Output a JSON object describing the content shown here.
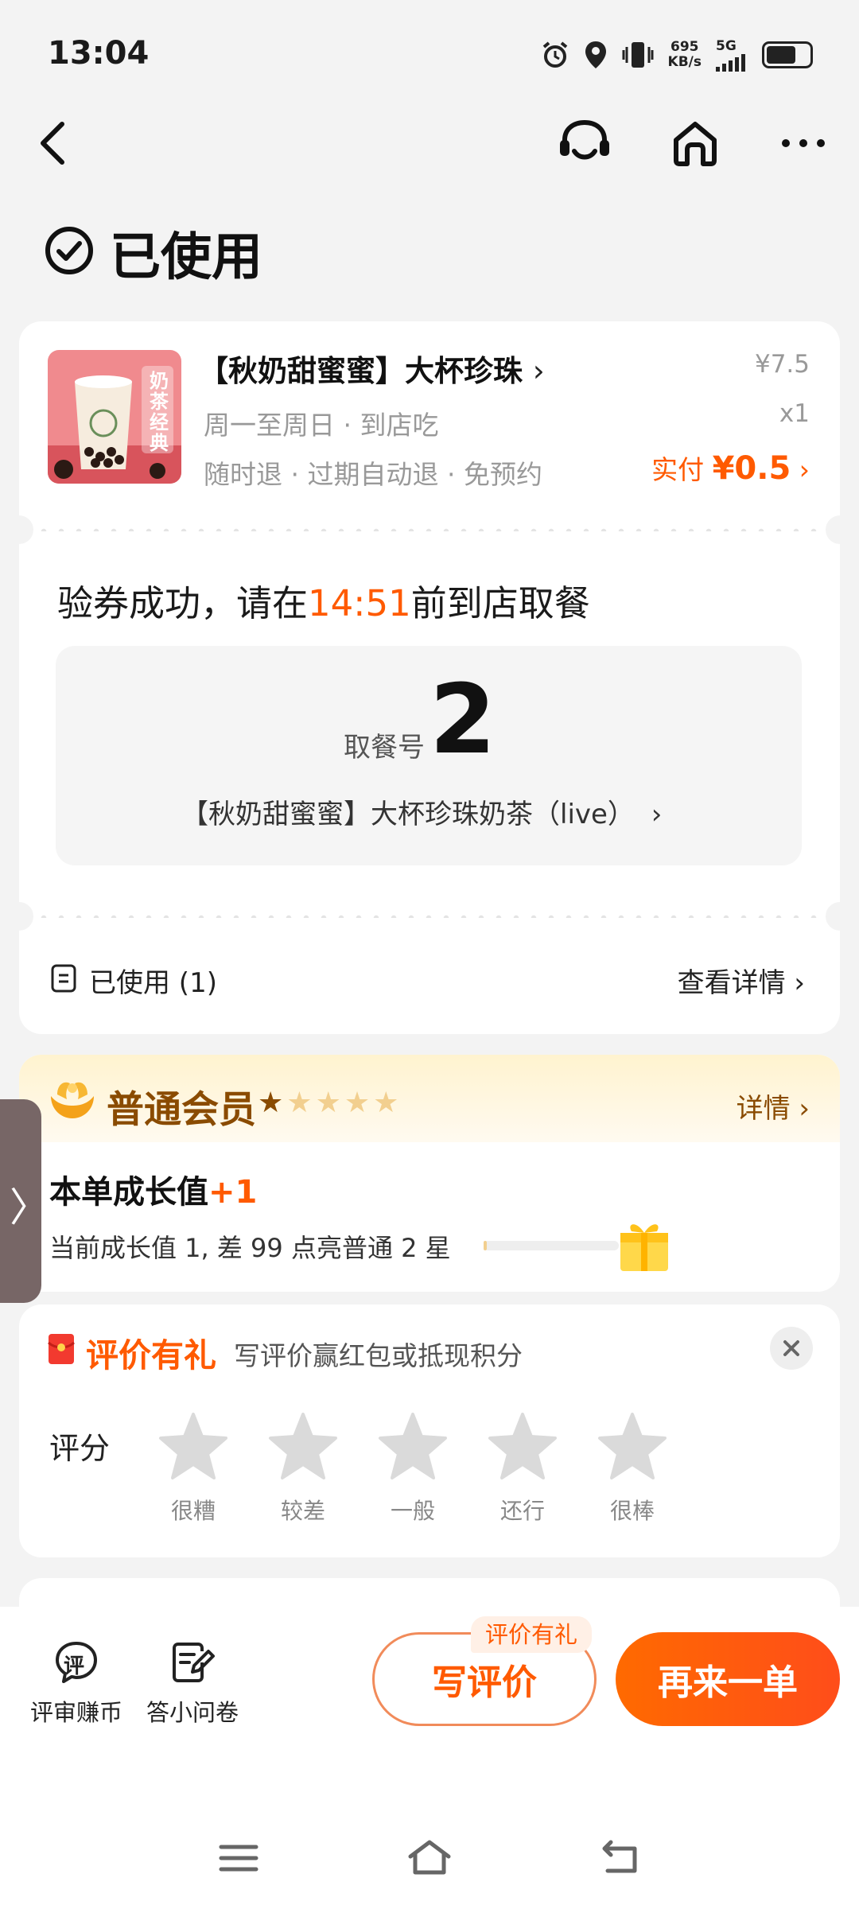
{
  "status_bar": {
    "time": "13:04",
    "net_speed_value": "695",
    "net_speed_unit": "KB/s",
    "network": "5G",
    "icons": [
      "alarm-icon",
      "location-icon",
      "vibrate-icon",
      "signal-icon",
      "battery-icon"
    ]
  },
  "nav": {
    "icons": [
      "back-arrow-icon",
      "customer-service-icon",
      "home-icon",
      "more-icon"
    ]
  },
  "page": {
    "title": "已使用"
  },
  "order": {
    "product_name": "【秋奶甜蜜蜜】大杯珍珠",
    "product_sub1": "周一至周日 · 到店吃",
    "product_sub2": "随时退 · 过期自动退 · 免预约",
    "price": "¥7.5",
    "quantity": "x1",
    "paid_label": "实付",
    "paid_amount": "¥0.5",
    "image_text": "奶茶经典",
    "verify_prefix": "验券成功，请在",
    "verify_time": "14:51",
    "verify_suffix": "前到店取餐",
    "pickup_label": "取餐号",
    "pickup_number": "2",
    "pickup_item": "【秋奶甜蜜蜜】大杯珍珠奶茶（live）",
    "used_label": "已使用 (1)",
    "view_detail": "查看详情"
  },
  "member": {
    "title": "普通会员",
    "stars_lit": 1,
    "stars_total": 5,
    "detail": "详情",
    "growth_title": "本单成长值",
    "growth_plus": "+1",
    "growth_desc": "当前成长值 1, 差 99 点亮普通 2 星",
    "growth_progress": 0.01,
    "side_tab": "〉"
  },
  "review": {
    "title": "评价有礼",
    "subtitle": "写评价赢红包或抵现积分",
    "rating_label": "评分",
    "stars": [
      "很糟",
      "较差",
      "一般",
      "还行",
      "很棒"
    ]
  },
  "bottom": {
    "item1": "评审赚币",
    "item1_icon_char": "评",
    "item2": "答小问卷",
    "tag": "评价有礼",
    "write_review": "写评价",
    "order_again": "再来一单"
  },
  "colors": {
    "accent": "#ff5a00",
    "member_brown": "#8a4b00",
    "background": "#f3f3f3"
  }
}
